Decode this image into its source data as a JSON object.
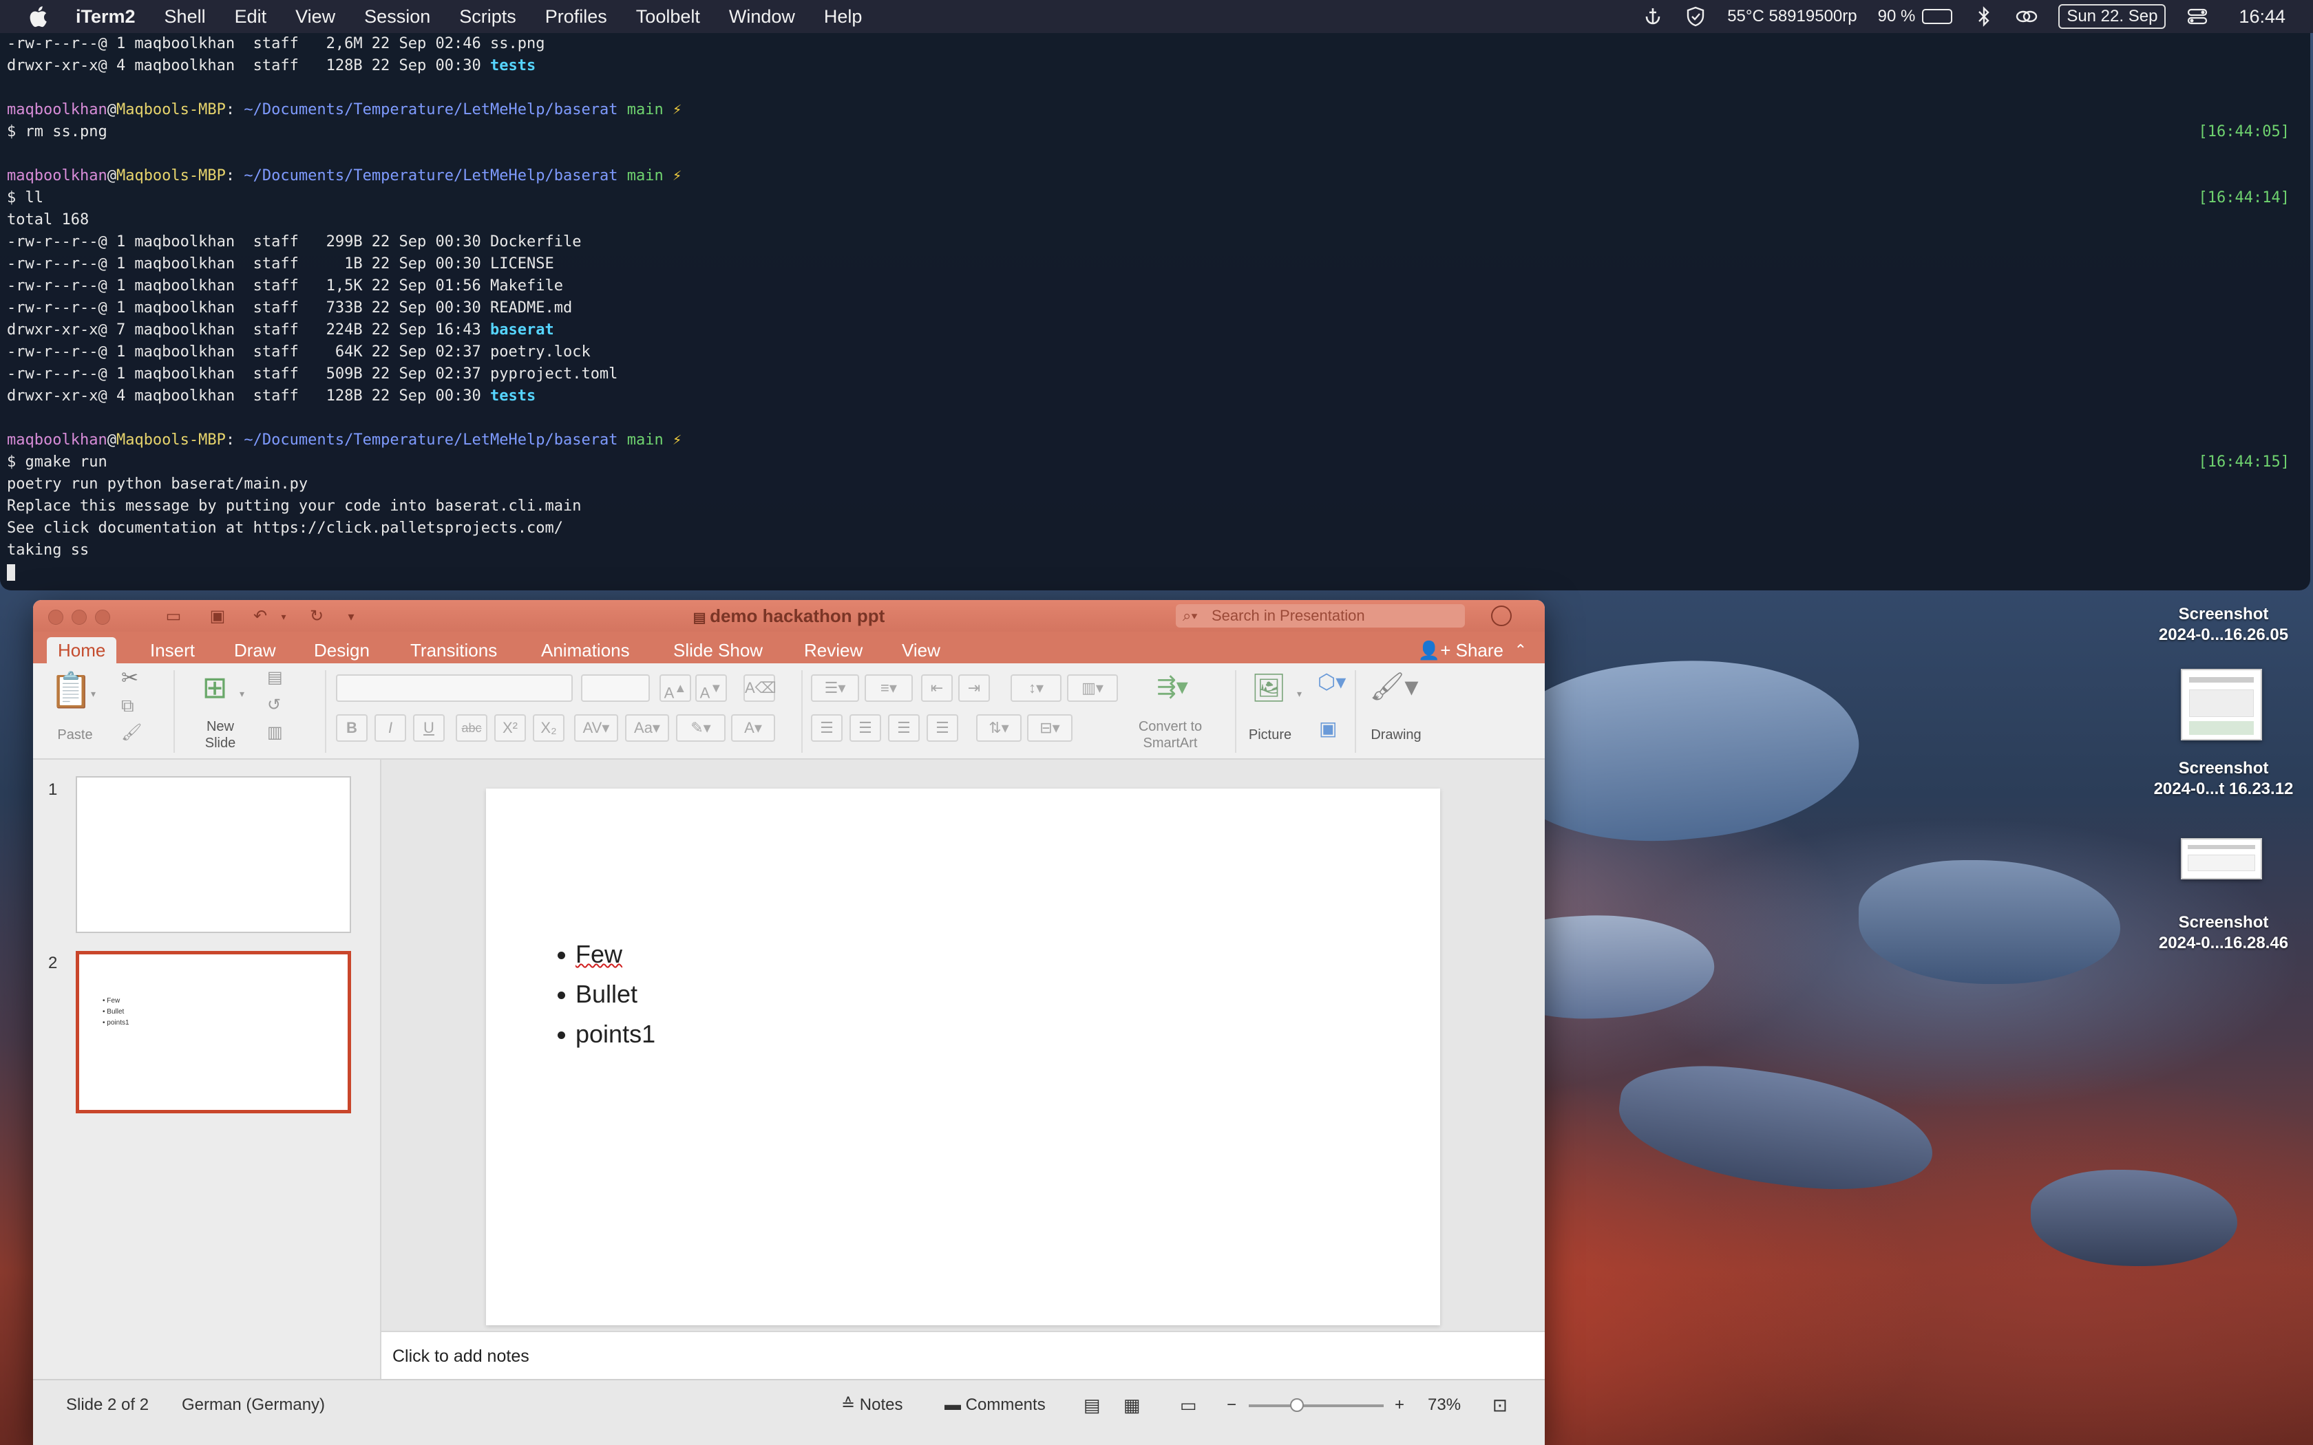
{
  "menubar": {
    "items": [
      "iTerm2",
      "Shell",
      "Edit",
      "View",
      "Session",
      "Scripts",
      "Profiles",
      "Toolbelt",
      "Window",
      "Help"
    ],
    "status_temp": "55°C 58919500rp",
    "battery": "90 %",
    "battery_level": 0.9,
    "date": "Sun 22. Sep",
    "time": "16:44"
  },
  "terminal": {
    "lines": [
      {
        "text": "-rw-r--r--@ 1 maqboolkhan  staff   2,6M 22 Sep 02:46 ss.png",
        "kind": "plain"
      },
      {
        "text": "drwxr-xr-x@ 4 maqboolkhan  staff   128B 22 Sep 00:30 ",
        "dir": "tests",
        "kind": "dir"
      },
      {
        "text": "",
        "kind": "plain"
      },
      {
        "kind": "prompt",
        "user": "maqboolkhan",
        "host": "Maqbools-MBP",
        "path": "~/Documents/Temperature/LetMeHelp/baserat",
        "branch": "main",
        "bolt": "⚡"
      },
      {
        "text": "$ rm ss.png",
        "kind": "plain",
        "stamp": "[16:44:05]"
      },
      {
        "text": "",
        "kind": "plain"
      },
      {
        "kind": "prompt",
        "user": "maqboolkhan",
        "host": "Maqbools-MBP",
        "path": "~/Documents/Temperature/LetMeHelp/baserat",
        "branch": "main",
        "bolt": "⚡"
      },
      {
        "text": "$ ll",
        "kind": "plain",
        "stamp": "[16:44:14]"
      },
      {
        "text": "total 168",
        "kind": "plain"
      },
      {
        "text": "-rw-r--r--@ 1 maqboolkhan  staff   299B 22 Sep 00:30 Dockerfile",
        "kind": "plain"
      },
      {
        "text": "-rw-r--r--@ 1 maqboolkhan  staff     1B 22 Sep 00:30 LICENSE",
        "kind": "plain"
      },
      {
        "text": "-rw-r--r--@ 1 maqboolkhan  staff   1,5K 22 Sep 01:56 Makefile",
        "kind": "plain"
      },
      {
        "text": "-rw-r--r--@ 1 maqboolkhan  staff   733B 22 Sep 00:30 README.md",
        "kind": "plain"
      },
      {
        "text": "drwxr-xr-x@ 7 maqboolkhan  staff   224B 22 Sep 16:43 ",
        "dir": "baserat",
        "kind": "dir"
      },
      {
        "text": "-rw-r--r--@ 1 maqboolkhan  staff    64K 22 Sep 02:37 poetry.lock",
        "kind": "plain"
      },
      {
        "text": "-rw-r--r--@ 1 maqboolkhan  staff   509B 22 Sep 02:37 pyproject.toml",
        "kind": "plain"
      },
      {
        "text": "drwxr-xr-x@ 4 maqboolkhan  staff   128B 22 Sep 00:30 ",
        "dir": "tests",
        "kind": "dir"
      },
      {
        "text": "",
        "kind": "plain"
      },
      {
        "kind": "prompt",
        "user": "maqboolkhan",
        "host": "Maqbools-MBP",
        "path": "~/Documents/Temperature/LetMeHelp/baserat",
        "branch": "main",
        "bolt": "⚡"
      },
      {
        "text": "$ gmake run",
        "kind": "plain",
        "stamp": "[16:44:15]"
      },
      {
        "text": "poetry run python baserat/main.py",
        "kind": "plain"
      },
      {
        "text": "Replace this message by putting your code into baserat.cli.main",
        "kind": "plain"
      },
      {
        "text": "See click documentation at https://click.palletsprojects.com/",
        "kind": "plain"
      },
      {
        "text": "taking ss",
        "kind": "plain"
      },
      {
        "kind": "cursor"
      }
    ]
  },
  "ppt": {
    "doc_title": "demo hackathon ppt",
    "search_placeholder": "Search in Presentation",
    "tabs": [
      "Home",
      "Insert",
      "Draw",
      "Design",
      "Transitions",
      "Animations",
      "Slide Show",
      "Review",
      "View"
    ],
    "share_label": "Share",
    "ribbon": {
      "paste": "Paste",
      "new_slide": "New\nSlide",
      "convert": "Convert to\nSmartArt",
      "picture": "Picture",
      "drawing": "Drawing"
    },
    "slides": [
      {
        "number": "1",
        "bullets": []
      },
      {
        "number": "2",
        "bullets": [
          "Few",
          "Bullet",
          "points1"
        ]
      }
    ],
    "current_slide_bullets": [
      "Few",
      "Bullet",
      "points1"
    ],
    "notes_placeholder": "Click to add notes",
    "status": {
      "slide_pos": "Slide 2 of 2",
      "language": "German (Germany)",
      "notes": "Notes",
      "comments": "Comments",
      "zoom": "73%"
    }
  },
  "desktop_icons": [
    {
      "name": "Screenshot",
      "sub": "2024-0...16.26.05"
    },
    {
      "name": "Screenshot",
      "sub": "2024-0...t 16.23.12"
    },
    {
      "name": "Screenshot",
      "sub": "2024-0...16.28.46"
    }
  ]
}
